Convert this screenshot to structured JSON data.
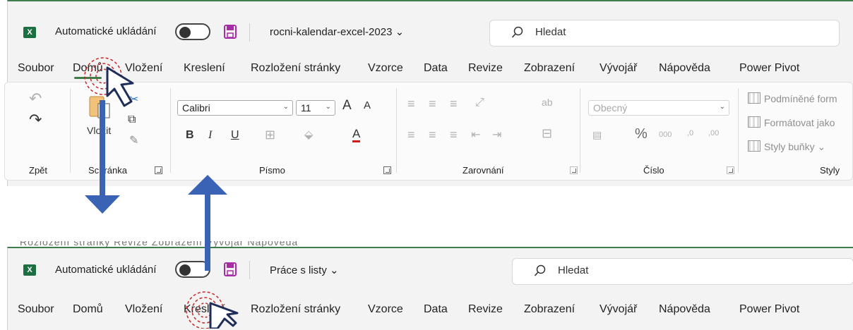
{
  "window_top": {
    "autosave_label": "Automatické ukládání",
    "document_name": "rocni-kalendar-excel-2023",
    "search_placeholder": "Hledat",
    "tabs": [
      "Soubor",
      "Domů",
      "Vložení",
      "Kreslení",
      "Rozložení stránky",
      "Vzorce",
      "Data",
      "Revize",
      "Zobrazení",
      "Vývojář",
      "Nápověda",
      "Power Pivot"
    ],
    "active_tab": "Domů"
  },
  "ribbon": {
    "groups": {
      "undo": "Zpět",
      "clipboard": "Schránka",
      "font": "Písmo",
      "alignment": "Zarovnání",
      "number": "Číslo",
      "styles": "Styly"
    },
    "paste_label": "Vložit",
    "font_name": "Calibri",
    "font_size": "11",
    "number_format": "Obecný",
    "bold": "B",
    "italic": "I",
    "underline": "U",
    "grow_font": "A",
    "shrink_font": "A",
    "font_color_glyph": "A",
    "percent": "%",
    "thousands": "000",
    "inc_decimal": ",0",
    "dec_decimal": ",00",
    "styles_items": [
      "Podmíněné form",
      "Formátovat jako",
      "Styly buňky"
    ]
  },
  "window_bottom": {
    "autosave_label": "Automatické ukládání",
    "document_name": "Práce s listy",
    "search_placeholder": "Hledat",
    "tabs": [
      "Soubor",
      "Domů",
      "Vložení",
      "Kreslení",
      "Rozložení stránky",
      "Vzorce",
      "Data",
      "Revize",
      "Zobrazení",
      "Vývojář",
      "Nápověda",
      "Power Pivot"
    ],
    "ghost_text": "Rozložení stránky   Revize   Zobrazení   Vývojář   Nápověda"
  },
  "colors": {
    "excel_green": "#1d6f42",
    "active_underline": "#3f7e4a",
    "arrow_blue": "#3a63b5",
    "click_circle": "#c62828",
    "save_purple": "#a72da7"
  }
}
